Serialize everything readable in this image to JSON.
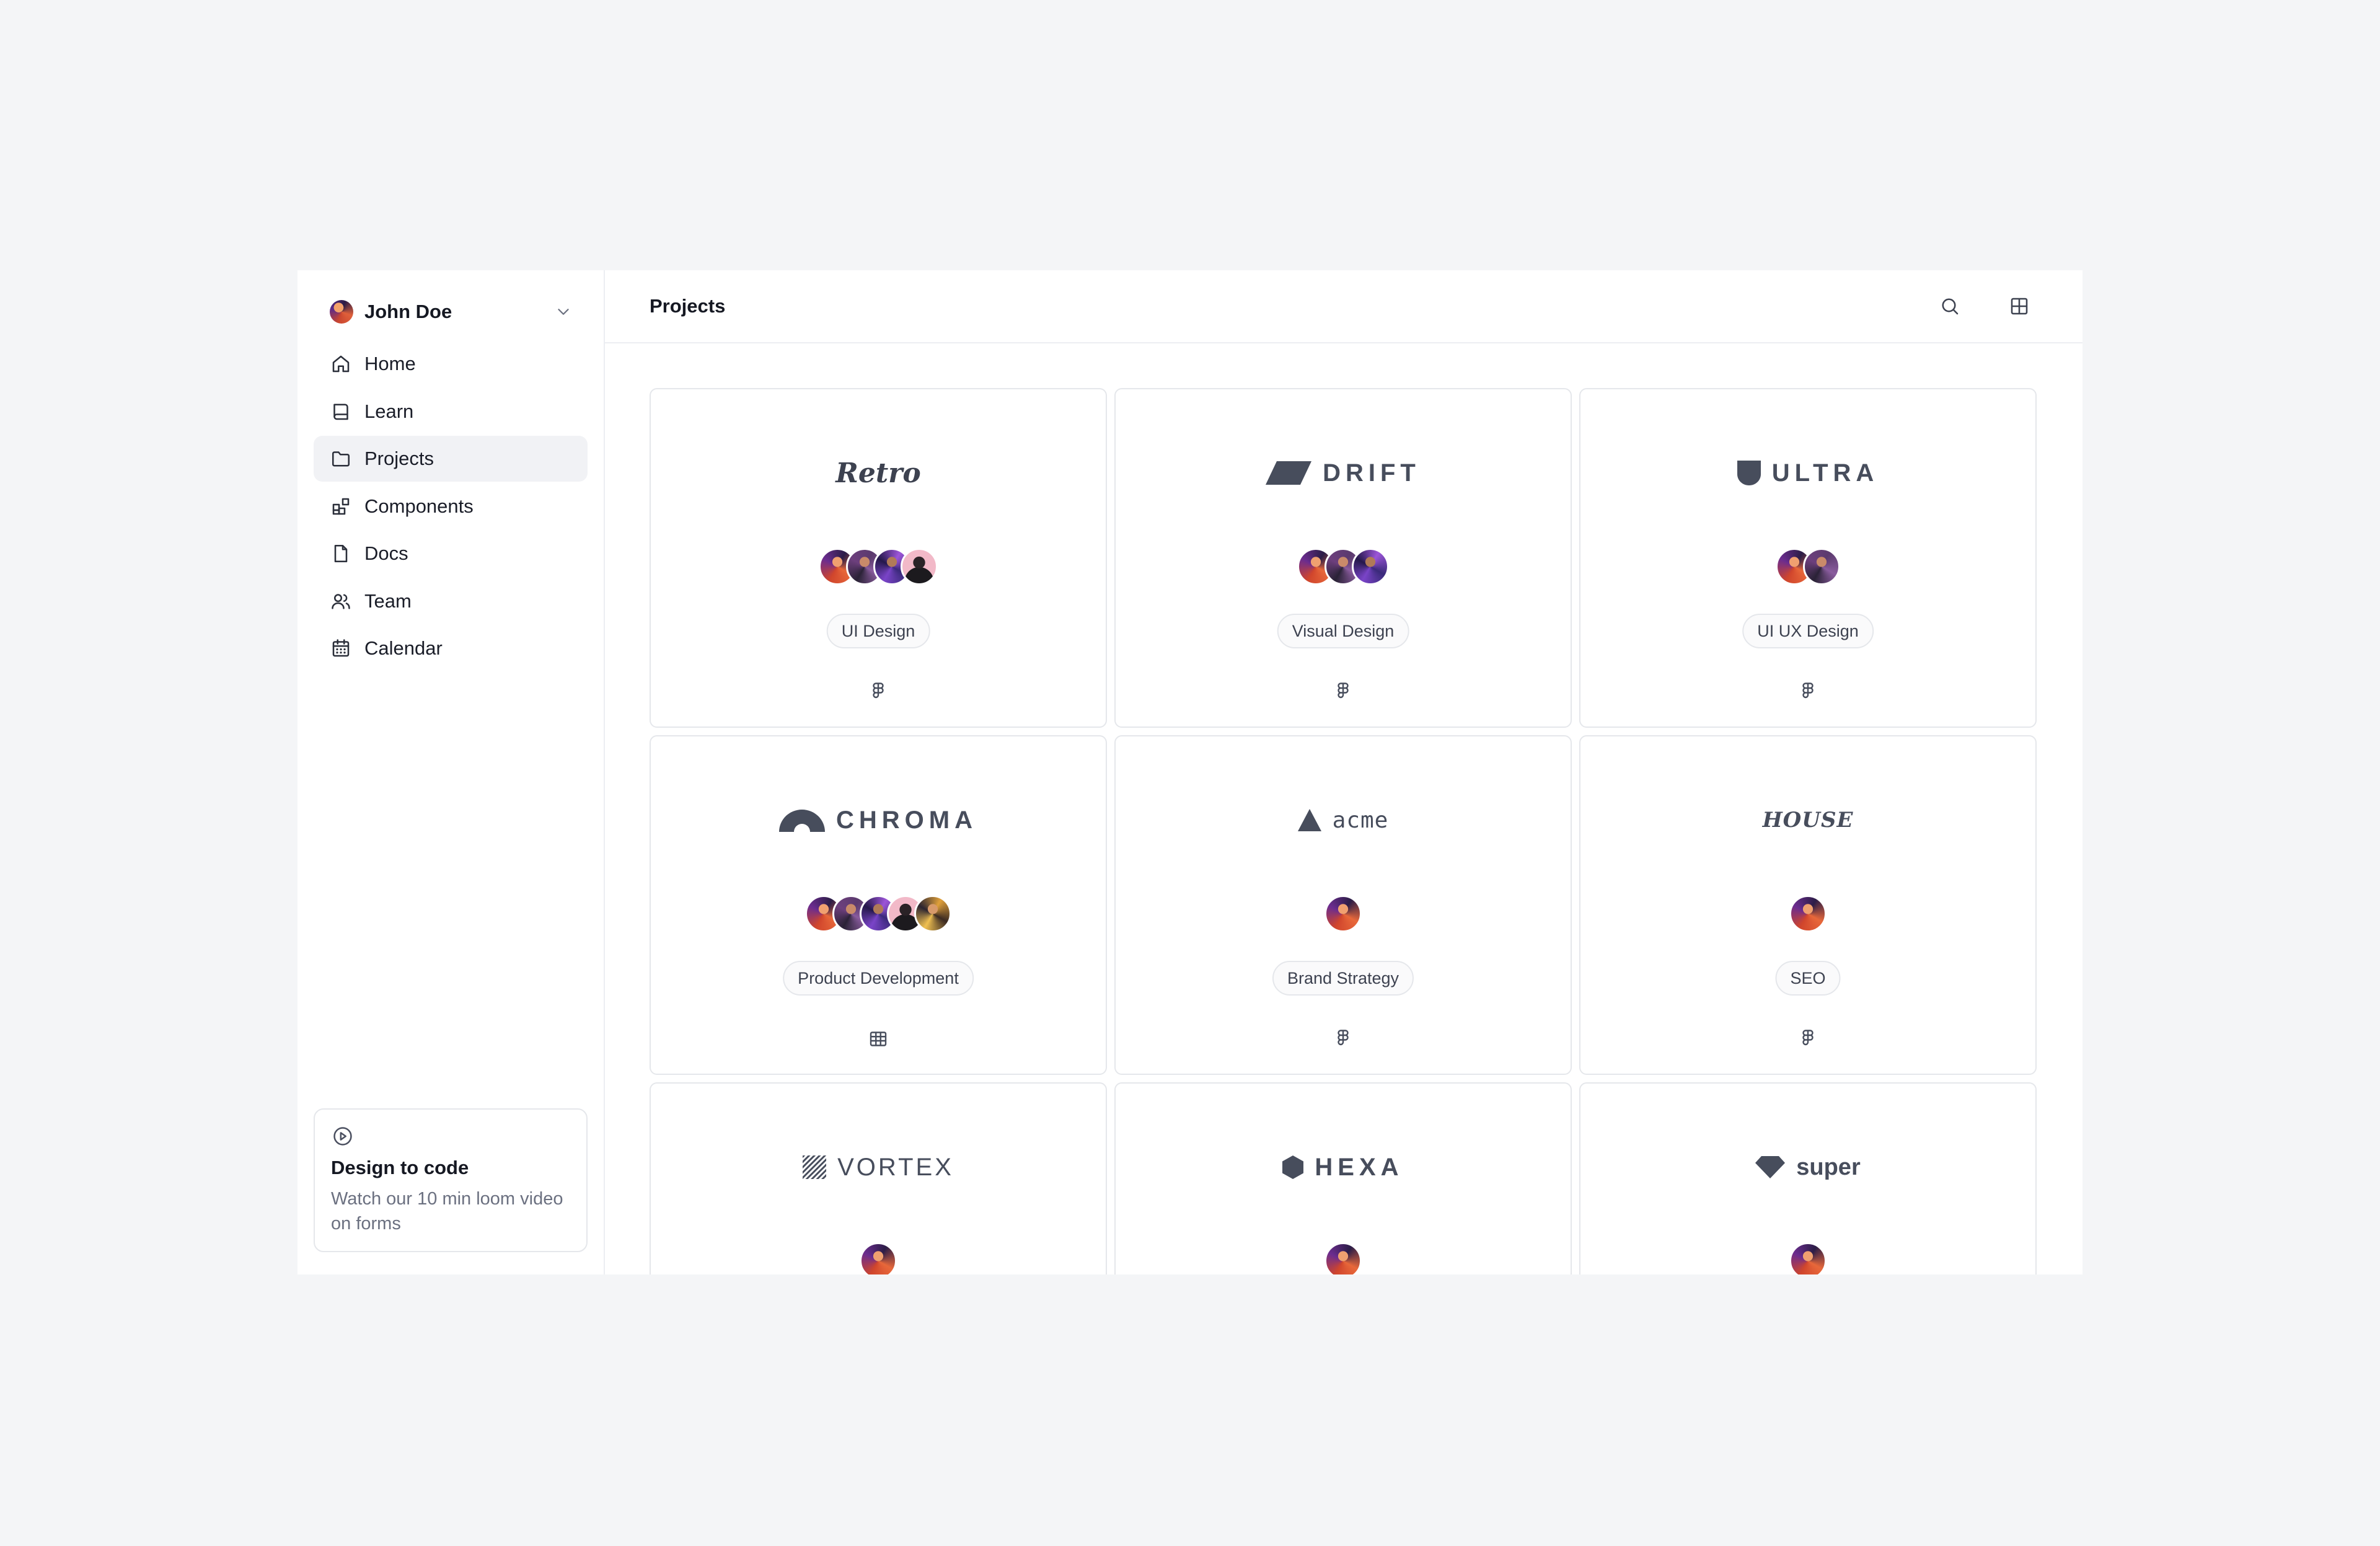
{
  "user": {
    "name": "John Doe"
  },
  "nav": [
    {
      "label": "Home",
      "icon": "home-icon"
    },
    {
      "label": "Learn",
      "icon": "book-icon"
    },
    {
      "label": "Projects",
      "icon": "folder-icon",
      "active": true
    },
    {
      "label": "Components",
      "icon": "components-icon"
    },
    {
      "label": "Docs",
      "icon": "file-icon"
    },
    {
      "label": "Team",
      "icon": "users-icon"
    },
    {
      "label": "Calendar",
      "icon": "calendar-icon"
    }
  ],
  "promo": {
    "title": "Design to code",
    "text": "Watch our 10 min loom video on forms",
    "icon": "play-circle-icon"
  },
  "header": {
    "title": "Projects",
    "search_icon": "search-icon",
    "layout_icon": "grid-layout-icon"
  },
  "projects": [
    {
      "logo": "Retro",
      "members": 4,
      "tag": "UI Design",
      "tool": "figma-icon"
    },
    {
      "logo": "DRIFT",
      "members": 3,
      "tag": "Visual Design",
      "tool": "figma-icon"
    },
    {
      "logo": "ULTRA",
      "members": 2,
      "tag": "UI UX Design",
      "tool": "figma-icon"
    },
    {
      "logo": "CHROMA",
      "members": 5,
      "tag": "Product Development",
      "tool": "table-icon"
    },
    {
      "logo": "acme",
      "members": 1,
      "tag": "Brand Strategy",
      "tool": "figma-icon"
    },
    {
      "logo": "HOUSE",
      "members": 1,
      "tag": "SEO",
      "tool": "figma-icon"
    },
    {
      "logo": "VORTEX",
      "members": 1
    },
    {
      "logo": "HEXA",
      "members": 1
    },
    {
      "logo": "super",
      "members": 1
    }
  ],
  "colors": {
    "accent_text": "#474d5c",
    "active_nav_bg": "#f1f2f5",
    "border": "#e5e7eb",
    "page_bg": "#f4f5f7"
  }
}
